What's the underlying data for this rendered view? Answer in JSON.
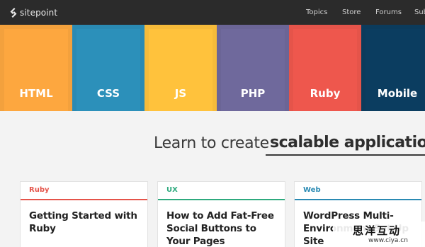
{
  "header": {
    "logo_text": "sitepoint",
    "logo_icon": "sitepoint-s-icon",
    "nav": [
      "Topics",
      "Store",
      "Forums",
      "Sub"
    ]
  },
  "tiles": [
    {
      "label": "HTML",
      "color": "#f3a13d"
    },
    {
      "label": "CSS",
      "color": "#2a8ab3"
    },
    {
      "label": "JS",
      "color": "#f6bb3a"
    },
    {
      "label": "PHP",
      "color": "#6b6596"
    },
    {
      "label": "Ruby",
      "color": "#e5544a"
    },
    {
      "label": "Mobile",
      "color": "#0b3b5c"
    }
  ],
  "lead": {
    "prefix": "Learn to create",
    "highlight": "scalable applications"
  },
  "cards": [
    {
      "tag": "Ruby",
      "tag_color": "#e5544a",
      "title": "Getting Started with Ruby"
    },
    {
      "tag": "UX",
      "tag_color": "#2eaa7e",
      "title": "How to Add Fat-Free Social Buttons to Your Pages"
    },
    {
      "tag": "Web",
      "tag_color": "#2a8ab3",
      "title": "WordPress Multi-Environment Set Up Site"
    }
  ],
  "watermark": {
    "main": "思洋互动",
    "sub": "www.ciya.cn"
  }
}
